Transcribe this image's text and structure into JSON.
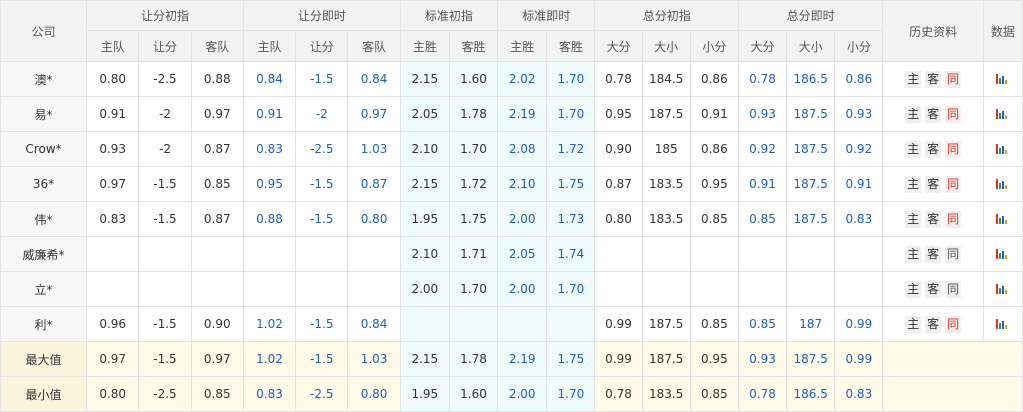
{
  "header": {
    "company": "公司",
    "groups": [
      "让分初指",
      "让分即时",
      "标准初指",
      "标准即时",
      "总分初指",
      "总分即时"
    ],
    "history": "历史资料",
    "data": "数据",
    "sub": [
      "主队",
      "让分",
      "客队",
      "主队",
      "让分",
      "客队",
      "主胜",
      "客胜",
      "主胜",
      "客胜",
      "大分",
      "大小",
      "小分",
      "大分",
      "大小",
      "小分"
    ]
  },
  "rows": [
    {
      "company": "澳*",
      "vals": [
        "0.80",
        "-2.5",
        "0.88",
        "0.84",
        "-1.5",
        "0.84",
        "2.15",
        "1.60",
        "2.02",
        "1.70",
        "0.78",
        "184.5",
        "0.86",
        "0.78",
        "186.5",
        "0.86"
      ],
      "btn_active": true
    },
    {
      "company": "易*",
      "vals": [
        "0.91",
        "-2",
        "0.97",
        "0.91",
        "-2",
        "0.97",
        "2.05",
        "1.78",
        "2.19",
        "1.70",
        "0.95",
        "187.5",
        "0.91",
        "0.93",
        "187.5",
        "0.93"
      ],
      "btn_active": true
    },
    {
      "company": "Crow*",
      "vals": [
        "0.93",
        "-2",
        "0.87",
        "0.83",
        "-2.5",
        "1.03",
        "2.10",
        "1.70",
        "2.08",
        "1.72",
        "0.90",
        "185",
        "0.86",
        "0.92",
        "187.5",
        "0.92"
      ],
      "btn_active": true
    },
    {
      "company": "36*",
      "vals": [
        "0.97",
        "-1.5",
        "0.85",
        "0.95",
        "-1.5",
        "0.87",
        "2.15",
        "1.72",
        "2.10",
        "1.75",
        "0.87",
        "183.5",
        "0.95",
        "0.91",
        "187.5",
        "0.91"
      ],
      "btn_active": true
    },
    {
      "company": "伟*",
      "vals": [
        "0.83",
        "-1.5",
        "0.87",
        "0.88",
        "-1.5",
        "0.80",
        "1.95",
        "1.75",
        "2.00",
        "1.73",
        "0.80",
        "183.5",
        "0.85",
        "0.85",
        "187.5",
        "0.83"
      ],
      "btn_active": true
    },
    {
      "company": "威廉希*",
      "vals": [
        "",
        "",
        "",
        "",
        "",
        "",
        "2.10",
        "1.71",
        "2.05",
        "1.74",
        "",
        "",
        "",
        "",
        "",
        ""
      ],
      "btn_active": false
    },
    {
      "company": "立*",
      "vals": [
        "",
        "",
        "",
        "",
        "",
        "",
        "2.00",
        "1.70",
        "2.00",
        "1.70",
        "",
        "",
        "",
        "",
        "",
        ""
      ],
      "btn_active": false
    },
    {
      "company": "利*",
      "vals": [
        "0.96",
        "-1.5",
        "0.90",
        "1.02",
        "-1.5",
        "0.84",
        "",
        "",
        "",
        "",
        "0.99",
        "187.5",
        "0.85",
        "0.85",
        "187",
        "0.99"
      ],
      "btn_active": true
    }
  ],
  "summary": [
    {
      "label": "最大值",
      "vals": [
        "0.97",
        "-1.5",
        "0.97",
        "1.02",
        "-1.5",
        "1.03",
        "2.15",
        "1.78",
        "2.19",
        "1.75",
        "0.99",
        "187.5",
        "0.95",
        "0.93",
        "187.5",
        "0.99"
      ]
    },
    {
      "label": "最小值",
      "vals": [
        "0.80",
        "-2.5",
        "0.85",
        "0.83",
        "-2.5",
        "0.80",
        "1.95",
        "1.60",
        "2.00",
        "1.70",
        "0.78",
        "183.5",
        "0.85",
        "0.78",
        "186.5",
        "0.83"
      ]
    }
  ],
  "buttons": {
    "home": "主",
    "away": "客",
    "same": "同"
  },
  "colors": {
    "blue": "#1e5fbf",
    "red": "#e0301e",
    "std_bg": "#eefbfa",
    "summary_bg": "#fffbe8"
  },
  "icons": {
    "data": "bar-chart-icon"
  }
}
